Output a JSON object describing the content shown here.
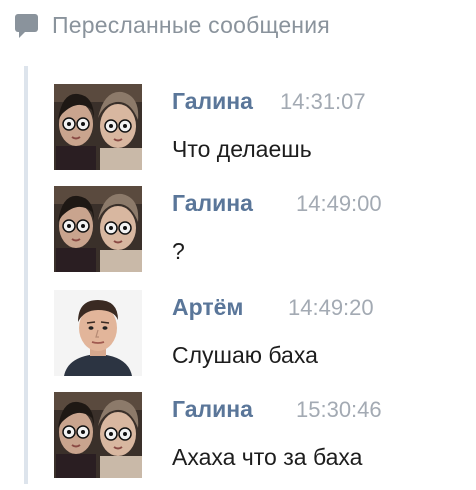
{
  "header": {
    "icon": "speech-bubble-icon",
    "title": "Пересланные сообщения"
  },
  "messages": [
    {
      "author": "Галина",
      "time": "14:31:07",
      "text": "Что делаешь",
      "avatar": "two-women-photo"
    },
    {
      "author": "Галина",
      "time": "14:49:00",
      "text": "?",
      "avatar": "two-women-photo"
    },
    {
      "author": "Артём",
      "time": "14:49:20",
      "text": "Слушаю баха",
      "avatar": "young-man-photo"
    },
    {
      "author": "Галина",
      "time": "15:30:46",
      "text": "Ахаха что за баха",
      "avatar": "two-women-photo"
    }
  ],
  "colors": {
    "author": "#5a7699",
    "time": "#a3aab3",
    "header": "#8a939c",
    "forward_line": "#dde4ec",
    "text": "#1d1d1d"
  }
}
